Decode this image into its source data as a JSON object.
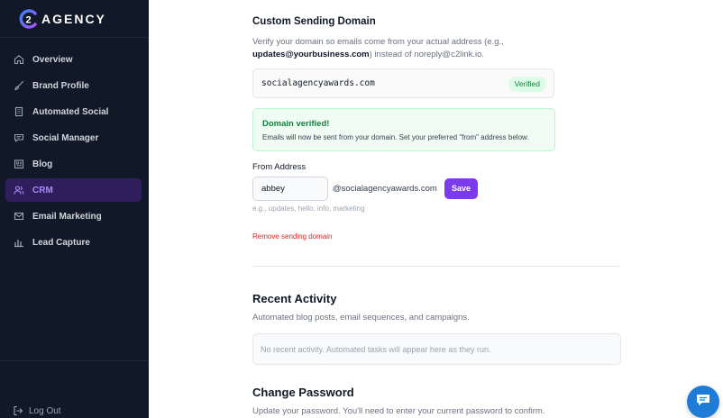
{
  "sidebar": {
    "brand": "AGENCY",
    "brand_mark": "C2",
    "items": [
      {
        "label": "Overview",
        "icon": "home-icon",
        "active": false
      },
      {
        "label": "Brand Profile",
        "icon": "brush-icon",
        "active": false
      },
      {
        "label": "Automated Social",
        "icon": "building-icon",
        "active": false
      },
      {
        "label": "Social Manager",
        "icon": "chat-icon",
        "active": false
      },
      {
        "label": "Blog",
        "icon": "newspaper-icon",
        "active": false
      },
      {
        "label": "CRM",
        "icon": "users-icon",
        "active": true
      },
      {
        "label": "Email Marketing",
        "icon": "mail-icon",
        "active": false
      },
      {
        "label": "Lead Capture",
        "icon": "bar-chart-icon",
        "active": false
      }
    ],
    "logout_label": "Log Out"
  },
  "sending_domain": {
    "title": "Custom Sending Domain",
    "desc_prefix": "Verify your domain so emails come from your actual address (e.g.,",
    "desc_example": "updates@yourbusiness.com",
    "desc_suffix": ") instead of noreply@c2link.io.",
    "domain": "socialagencyawards.com",
    "status_badge": "Verified",
    "verified_title": "Domain verified!",
    "verified_body": "Emails will now be sent from your domain. Set your preferred \"from\" address below.",
    "from_label": "From Address",
    "from_value": "abbey",
    "from_suffix": "@socialagencyawards.com",
    "save_label": "Save",
    "hint": "e.g., updates, hello, info, marketing",
    "remove_label": "Remove sending domain"
  },
  "recent_activity": {
    "title": "Recent Activity",
    "desc": "Automated blog posts, email sequences, and campaigns.",
    "empty_text": "No recent activity. Automated tasks will appear here as they run."
  },
  "change_password": {
    "title": "Change Password",
    "desc": "Update your password. You'll need to enter your current password to confirm."
  },
  "colors": {
    "sidebar_bg": "#111827",
    "accent": "#7c3aed",
    "active_bg": "#2e1f5c",
    "success": "#15803d",
    "danger": "#dc2626",
    "chat": "#1e7bd6"
  }
}
